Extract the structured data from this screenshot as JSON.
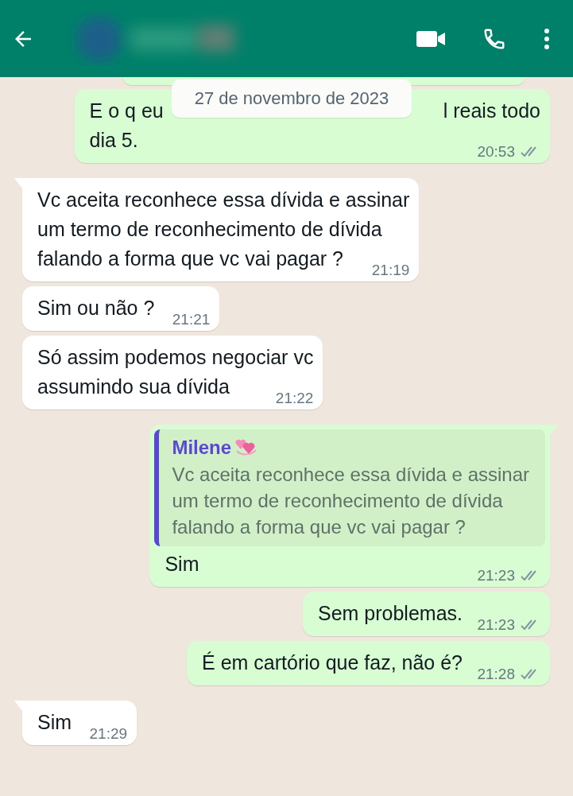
{
  "date_chip": "27 de novembro de 2023",
  "messages": [
    {
      "kind": "outgoing",
      "tail": false,
      "covered_line": [
        "E o q eu",
        "l reais todo"
      ],
      "text": "dia 5.",
      "time": "20:53",
      "ticks": true,
      "read": false
    },
    {
      "kind": "incoming",
      "tail": true,
      "text": "Vc aceita reconhece essa dívida e assinar\num termo de reconhecimento de dívida\nfalando a forma que vc vai pagar ?",
      "time": "21:19"
    },
    {
      "kind": "incoming",
      "tail": false,
      "text": "Sim ou não ?",
      "time": "21:21"
    },
    {
      "kind": "incoming",
      "tail": false,
      "text": "Só assim podemos negociar vc\nassumindo sua dívida",
      "time": "21:22"
    },
    {
      "kind": "outgoing",
      "tail": true,
      "quote": {
        "author": "Milene",
        "text": "Vc aceita reconhece essa dívida e assinar\num termo de reconhecimento de dívida\nfalando a forma que vc vai pagar ?"
      },
      "text": "Sim",
      "time": "21:23",
      "ticks": true,
      "read": false
    },
    {
      "kind": "outgoing",
      "tail": false,
      "text": "Sem problemas.",
      "time": "21:23",
      "ticks": true,
      "read": false
    },
    {
      "kind": "outgoing",
      "tail": false,
      "text": "É em cartório que faz, não é?",
      "time": "21:28",
      "ticks": true,
      "read": false
    },
    {
      "kind": "incoming",
      "tail": true,
      "text": "Sim",
      "time": "21:29"
    }
  ]
}
